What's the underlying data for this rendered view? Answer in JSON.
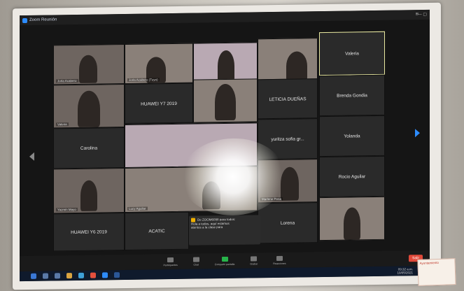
{
  "window": {
    "title": "Zoom Reunión"
  },
  "tiles": [
    {
      "name": "Jorla Acabero"
    },
    {
      "name": "Jorla Acabero (Tuyo)"
    },
    {
      "name": ""
    },
    {
      "name": ""
    },
    {
      "name": "Valeria",
      "active": true
    },
    {
      "name": "Valeria"
    },
    {
      "name": "HUAWEI Y7 2019"
    },
    {
      "name": ""
    },
    {
      "name": "LETICIA DUEÑAS"
    },
    {
      "name": "Brenda Gondia"
    },
    {
      "name": "Carolina"
    },
    {
      "name": "yuritza sofia gr..."
    },
    {
      "name": "Yolanda"
    },
    {
      "name": "Rocio Aguilar"
    },
    {
      "name": "Yazmin Mayo"
    },
    {
      "name": "Lucy Aguilar"
    },
    {
      "name": "Marlene Pena"
    },
    {
      "name": "HUAWEI Y6 2019"
    },
    {
      "name": "ACATIC"
    },
    {
      "name": "Lorena"
    }
  ],
  "chat_popup": {
    "line1": "De ZOOM6098 para todos:",
    "line2": "Hola a todos, aquí estamos",
    "line3": "atentos a la clase para"
  },
  "toolbar": {
    "items": [
      {
        "label": "Participantes"
      },
      {
        "label": "Chat"
      },
      {
        "label": "Compartir pantalla"
      },
      {
        "label": "Grabar"
      },
      {
        "label": "Reacciones"
      }
    ],
    "end_label": "Salir"
  },
  "taskbar": {
    "time": "09:32 a.m.",
    "date": "10/05/2021"
  },
  "sticker": {
    "text": "Ayuntamiento"
  }
}
